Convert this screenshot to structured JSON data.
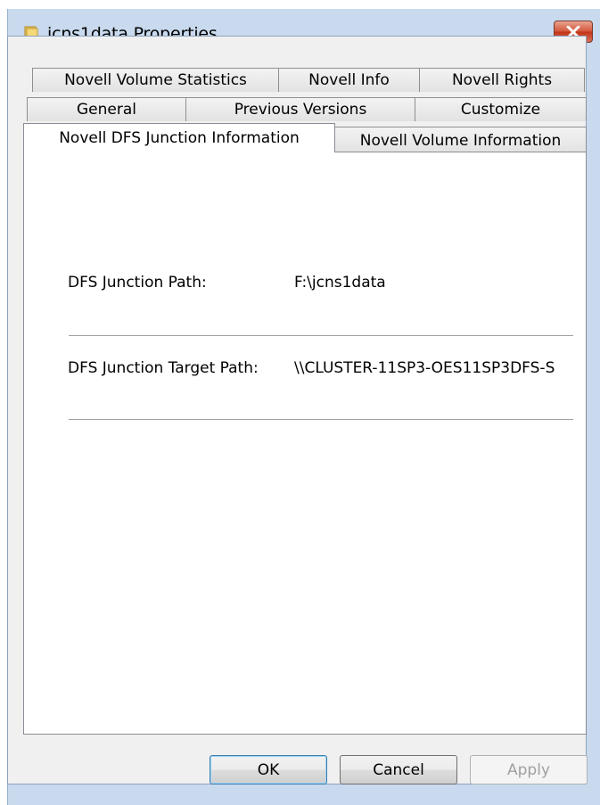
{
  "window": {
    "title": "jcns1data Properties",
    "icon": "folder-icon",
    "close_icon": "close-icon",
    "close_color": "#c8391a"
  },
  "tabs": {
    "row1": [
      "Novell Volume Statistics",
      "Novell Info",
      "Novell Rights"
    ],
    "row2": [
      "General",
      "Previous Versions",
      "Customize"
    ],
    "row3": [
      "Novell DFS Junction Information",
      "Novell Volume Information"
    ],
    "active": "Novell DFS Junction Information"
  },
  "fields": {
    "junction_path_label": "DFS Junction Path:",
    "junction_path_value": "F:\\jcns1data",
    "target_path_label": "DFS Junction Target Path:",
    "target_path_value": "\\\\CLUSTER-11SP3-OES11SP3DFS-S"
  },
  "buttons": {
    "ok": "OK",
    "cancel": "Cancel",
    "apply": "Apply"
  }
}
